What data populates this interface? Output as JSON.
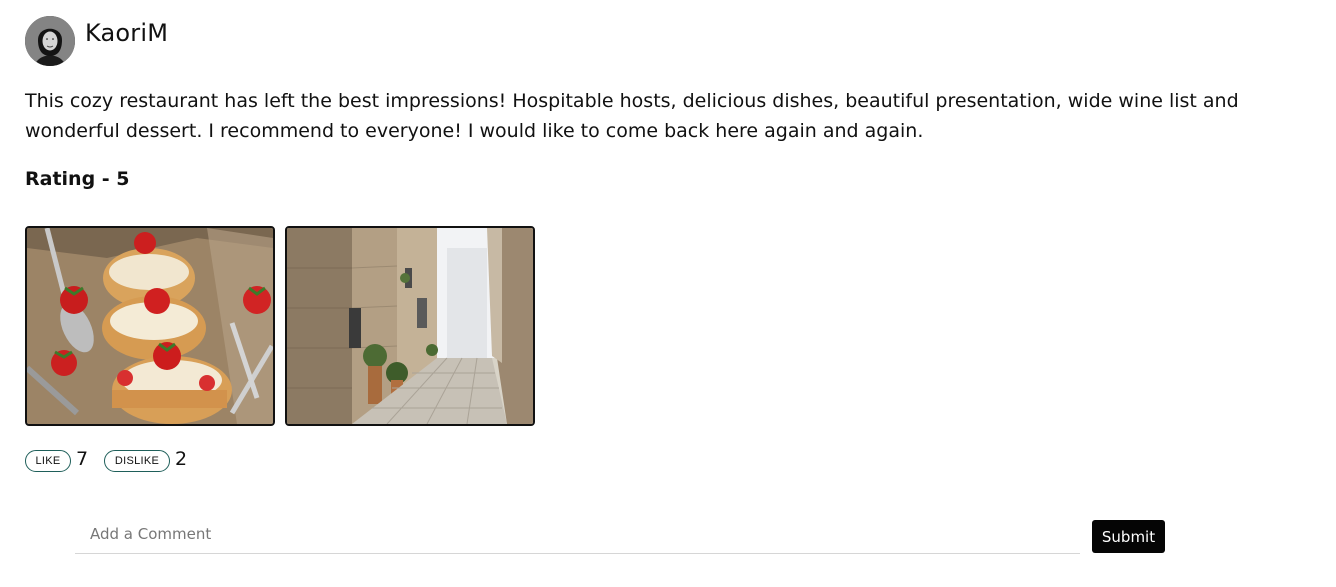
{
  "review": {
    "author": {
      "name": "KaoriM",
      "avatar_icon": "user-avatar-photo"
    },
    "text": "This cozy restaurant has left the best impressions! Hospitable hosts, delicious dishes, beautiful presentation, wide wine list and wonderful dessert. I recommend to everyone! I would like to come back here again and again.",
    "rating_label": "Rating - 5",
    "rating": 5,
    "photos": [
      {
        "subject": "strawberry-cream-puffs-dessert"
      },
      {
        "subject": "narrow-stone-street"
      }
    ],
    "reactions": {
      "like_label": "LIKE",
      "like_count": "7",
      "dislike_label": "DISLIKE",
      "dislike_count": "2"
    },
    "comment": {
      "placeholder": "Add a Comment",
      "value": "",
      "submit_label": "Submit"
    }
  }
}
